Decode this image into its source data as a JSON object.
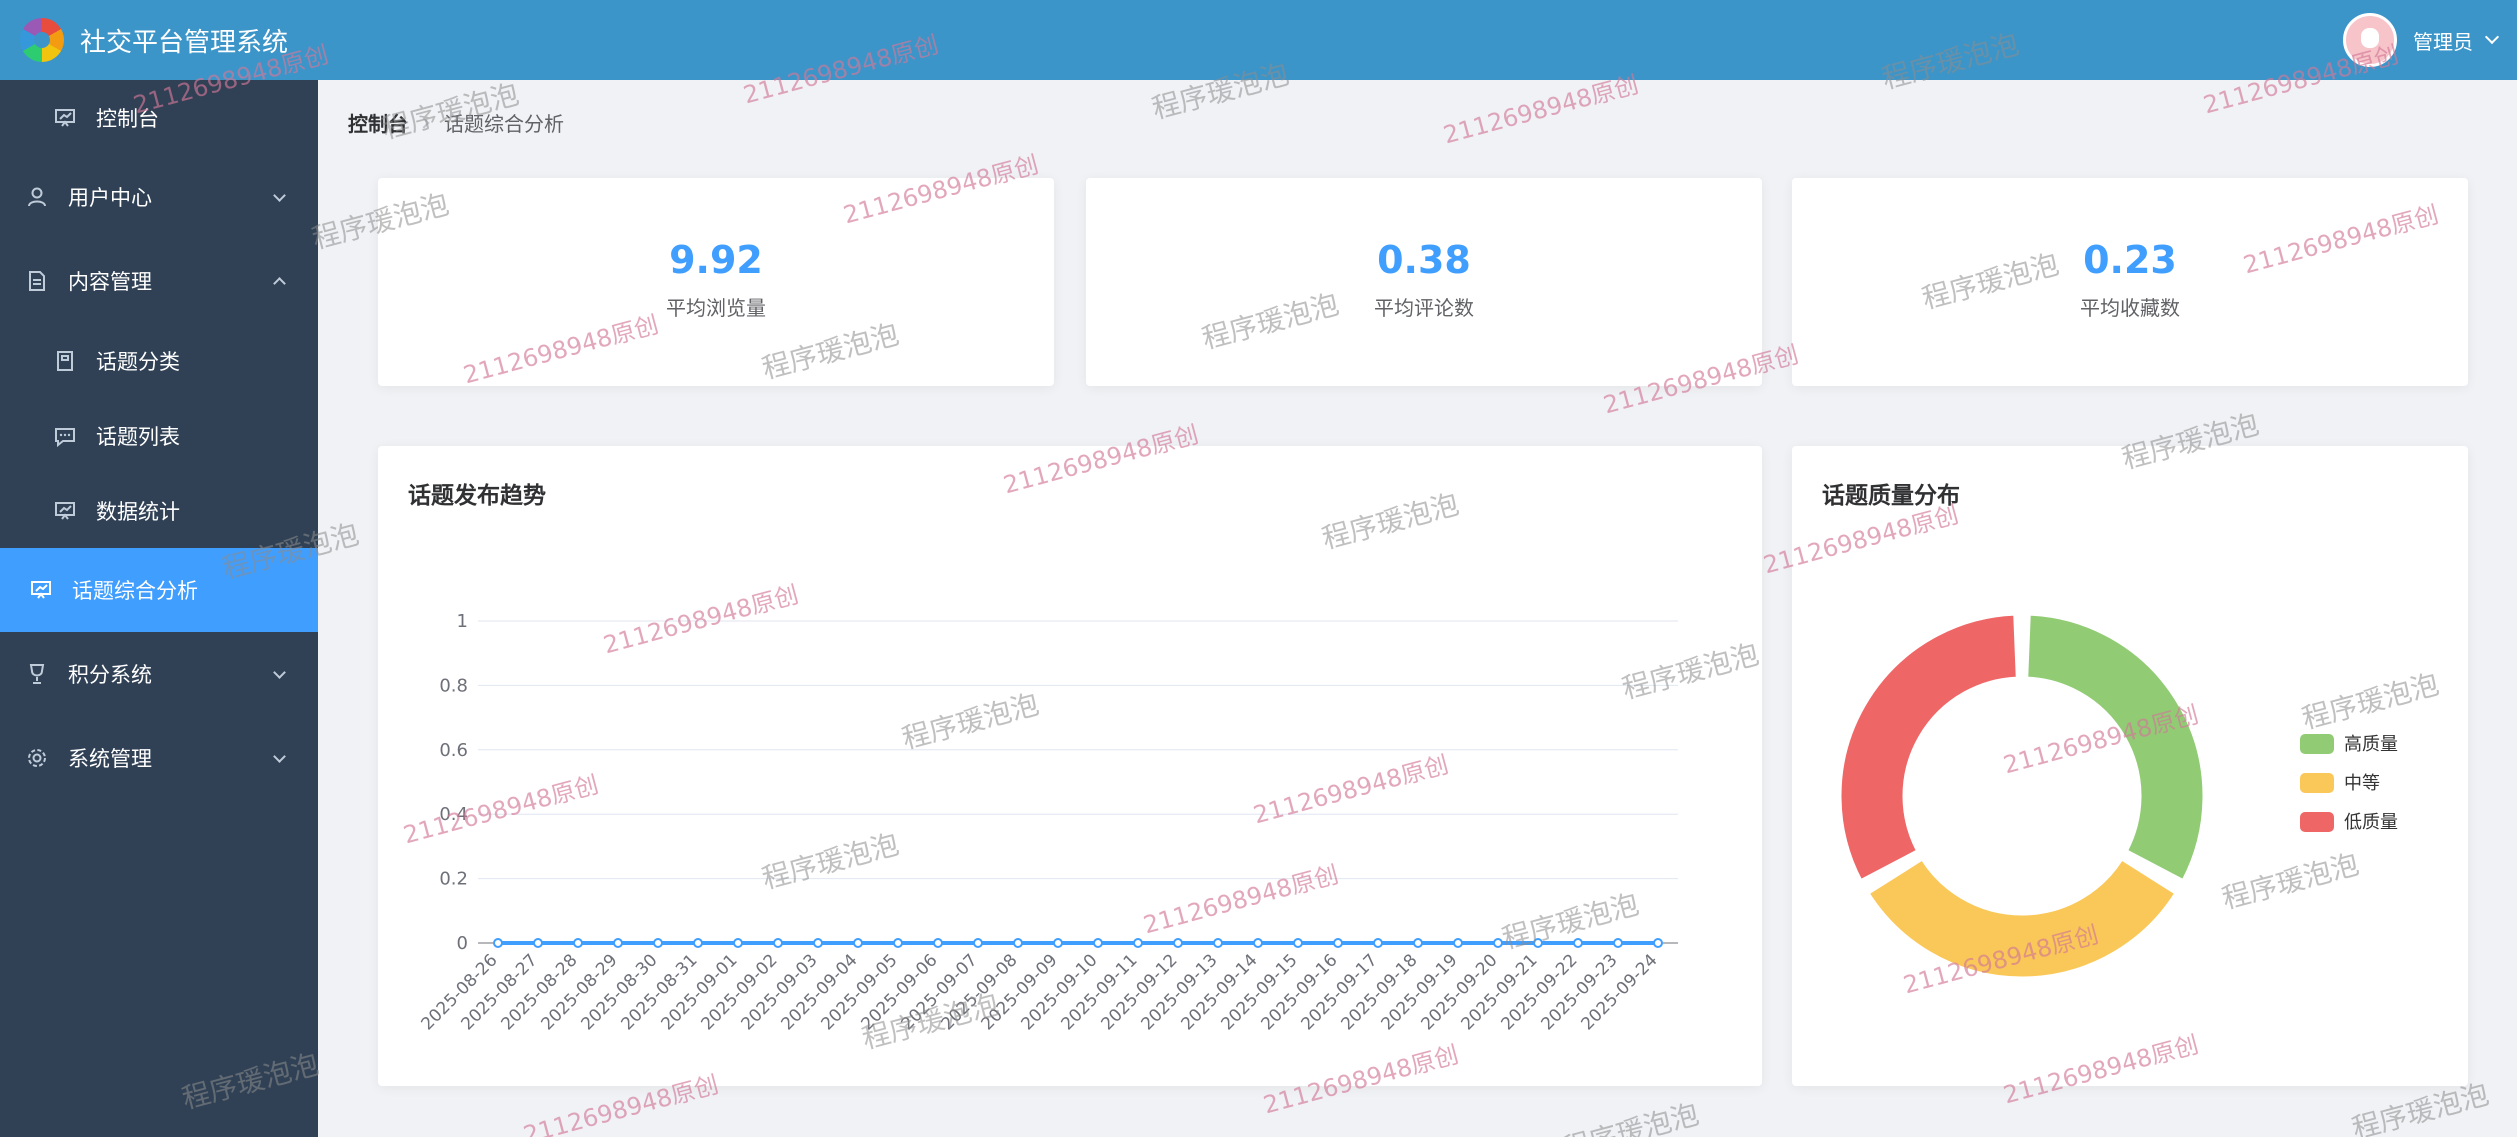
{
  "header": {
    "title": "社交平台管理系统",
    "user": "管理员"
  },
  "sidebar": {
    "items": [
      {
        "label": "控制台",
        "icon": "dashboard-icon",
        "level": "sub"
      },
      {
        "label": "用户中心",
        "icon": "user-icon",
        "level": "top",
        "arrow": "down"
      },
      {
        "label": "内容管理",
        "icon": "document-icon",
        "level": "top",
        "arrow": "up"
      },
      {
        "label": "话题分类",
        "icon": "category-icon",
        "level": "sub"
      },
      {
        "label": "话题列表",
        "icon": "chat-icon",
        "level": "sub"
      },
      {
        "label": "数据统计",
        "icon": "stats-icon",
        "level": "sub"
      },
      {
        "label": "话题综合分析",
        "icon": "analysis-icon",
        "level": "active"
      },
      {
        "label": "积分系统",
        "icon": "points-icon",
        "level": "top",
        "arrow": "down"
      },
      {
        "label": "系统管理",
        "icon": "settings-icon",
        "level": "top",
        "arrow": "down"
      }
    ]
  },
  "breadcrumb": {
    "home": "控制台",
    "current": "话题综合分析"
  },
  "stats": [
    {
      "value": "9.92",
      "label": "平均浏览量"
    },
    {
      "value": "0.38",
      "label": "平均评论数"
    },
    {
      "value": "0.23",
      "label": "平均收藏数"
    }
  ],
  "trend": {
    "title": "话题发布趋势"
  },
  "quality": {
    "title": "话题质量分布"
  },
  "colors": {
    "header": "#3c95c9",
    "sidebar": "#304156",
    "active": "#409eff",
    "line": "#409eff",
    "green": "#91cc75",
    "yellow": "#fac858",
    "red": "#ee6666"
  },
  "watermark": {
    "text_a": "程序瑗泡泡",
    "text_b": "2112698948原创"
  },
  "chart_data": [
    {
      "type": "line",
      "x": [
        "2025-08-26",
        "2025-08-27",
        "2025-08-28",
        "2025-08-29",
        "2025-08-30",
        "2025-08-31",
        "2025-09-01",
        "2025-09-02",
        "2025-09-03",
        "2025-09-04",
        "2025-09-05",
        "2025-09-06",
        "2025-09-07",
        "2025-09-08",
        "2025-09-09",
        "2025-09-10",
        "2025-09-11",
        "2025-09-12",
        "2025-09-13",
        "2025-09-14",
        "2025-09-15",
        "2025-09-16",
        "2025-09-17",
        "2025-09-18",
        "2025-09-19",
        "2025-09-20",
        "2025-09-21",
        "2025-09-22",
        "2025-09-23",
        "2025-09-24"
      ],
      "y": [
        0,
        0,
        0,
        0,
        0,
        0,
        0,
        0,
        0,
        0,
        0,
        0,
        0,
        0,
        0,
        0,
        0,
        0,
        0,
        0,
        0,
        0,
        0,
        0,
        0,
        0,
        0,
        0,
        0,
        0
      ],
      "ylim": [
        0,
        1
      ],
      "yticks": [
        "0",
        "0.2",
        "0.4",
        "0.6",
        "0.8",
        "1"
      ],
      "grid": true
    },
    {
      "type": "pie",
      "donut": true,
      "legend": "right",
      "series": [
        {
          "name": "高质量",
          "value": 1,
          "color": "#91cc75"
        },
        {
          "name": "中等",
          "value": 1,
          "color": "#fac858"
        },
        {
          "name": "低质量",
          "value": 1,
          "color": "#ee6666"
        }
      ]
    }
  ]
}
